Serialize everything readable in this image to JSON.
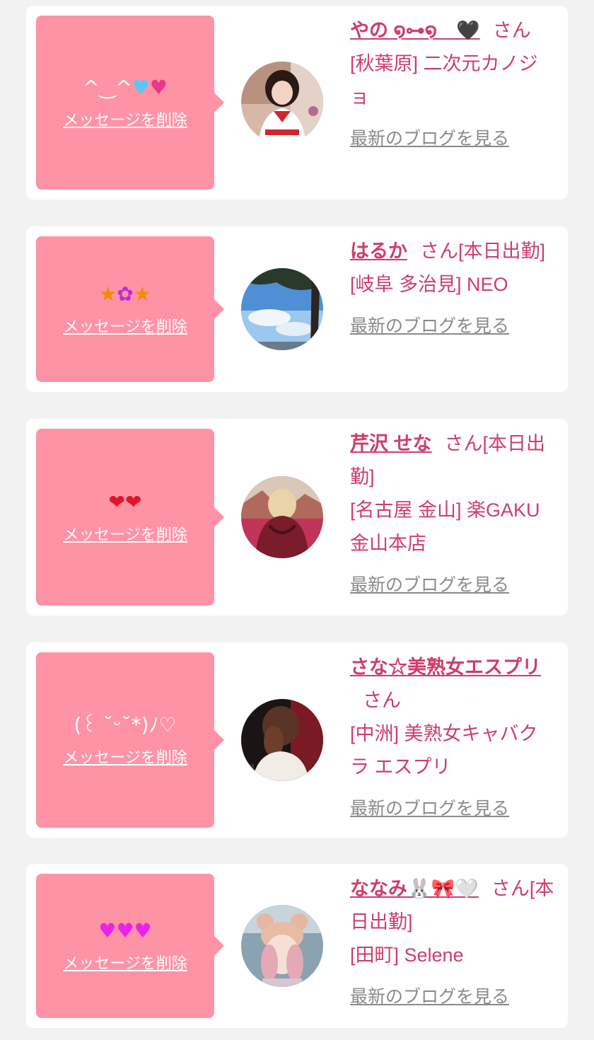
{
  "colors": {
    "page_bg": "#f2f2f2",
    "card_bg": "#ffffff",
    "bubble_bg": "#fd93a5",
    "accent_text": "#cf3d6a",
    "blog_link": "#8a8a8a"
  },
  "cards": [
    {
      "message": "^‿^",
      "message_emoji": [
        "blue-heart",
        "two-hearts"
      ],
      "delete_label": "メッセージを削除",
      "name": "やの ໑⊶໑　🖤",
      "honorific": "さん",
      "shop": "[秋葉原] 二次元カノジョ",
      "blog_label": "最新のブログを見る",
      "avatar_icon": "girl-in-sailor-uniform-photo"
    },
    {
      "message": "",
      "message_emoji": [
        "star",
        "bouquet",
        "star"
      ],
      "delete_label": "メッセージを削除",
      "name": "はるか",
      "honorific": "さん[本日出勤]",
      "shop": "[岐阜 多治見] NEO",
      "blog_label": "最新のブログを見る",
      "avatar_icon": "sky-and-tree-photo"
    },
    {
      "message": "",
      "message_emoji": [
        "red-heart",
        "red-heart"
      ],
      "delete_label": "メッセージを削除",
      "name": "芹沢 せな",
      "honorific": "さん[本日出勤]",
      "shop": "[名古屋 金山] 楽GAKU 金山本店",
      "blog_label": "最新のブログを見る",
      "avatar_icon": "red-leather-jacket-photo"
    },
    {
      "message": "(꒰ ˘ᵕ˘*)ﾉ♡",
      "message_emoji": [],
      "delete_label": "メッセージを削除",
      "name": "さな☆美熟女エスプリ",
      "honorific": "さん",
      "shop": "[中洲] 美熟女キャバクラ エスプリ",
      "blog_label": "最新のブログを見る",
      "avatar_icon": "hair-and-white-dress-photo"
    },
    {
      "message": "",
      "message_emoji": [
        "heart-purple",
        "heart-purple",
        "heart-purple"
      ],
      "delete_label": "メッセージを削除",
      "name": "ななみ🐰🎀🤍",
      "honorific": "さん[本日出勤]",
      "shop": "[田町] Selene",
      "blog_label": "最新のブログを見る",
      "avatar_icon": "girl-with-bear-ears-photo"
    }
  ]
}
